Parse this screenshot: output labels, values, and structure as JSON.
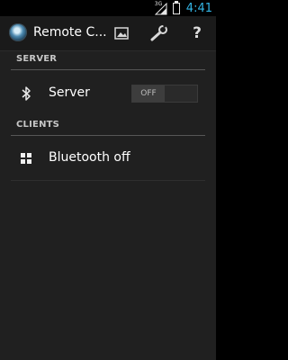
{
  "status": {
    "network": "3G",
    "time": "4:41",
    "clock_color": "#33b5e5"
  },
  "app": {
    "title": "Remote C...",
    "actions": {
      "gallery_icon": "gallery-icon",
      "settings_icon": "wrench-icon",
      "help_label": "?"
    }
  },
  "sections": {
    "server": {
      "header": "SERVER",
      "item_label": "Server",
      "item_icon": "bluetooth-icon",
      "toggle_label": "OFF"
    },
    "clients": {
      "header": "CLIENTS",
      "item_label": "Bluetooth off",
      "item_icon": "grid-icon"
    }
  }
}
